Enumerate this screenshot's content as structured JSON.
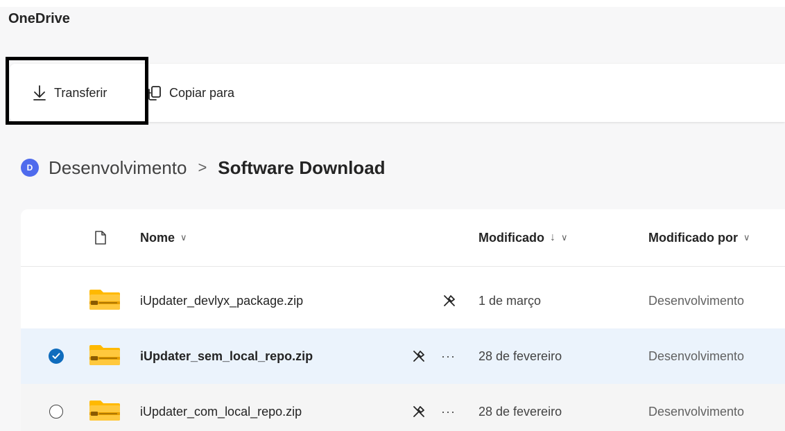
{
  "app": {
    "title": "OneDrive"
  },
  "toolbar": {
    "download_label": "Transferir",
    "copy_label": "Copiar para"
  },
  "breadcrumb": {
    "avatar_letter": "D",
    "parent": "Desenvolvimento",
    "separator": ">",
    "current": "Software Download"
  },
  "table": {
    "columns": {
      "name": "Nome",
      "modified": "Modificado",
      "modified_by": "Modificado por"
    },
    "sort_arrow": "↓",
    "chevron": "∨",
    "more_label": "···",
    "rows": [
      {
        "name": "iUpdater_devlyx_package.zip",
        "modified": "1 de março",
        "modified_by": "Desenvolvimento",
        "selected": false
      },
      {
        "name": "iUpdater_sem_local_repo.zip",
        "modified": "28 de fevereiro",
        "modified_by": "Desenvolvimento",
        "selected": true
      },
      {
        "name": "iUpdater_com_local_repo.zip",
        "modified": "28 de fevereiro",
        "modified_by": "Desenvolvimento",
        "selected": false
      }
    ]
  },
  "colors": {
    "accent": "#0f6cbd",
    "avatar": "#4f6bed",
    "folder_zip": "#ffb900",
    "selected_row": "#ebf3fc",
    "focus_outline": "#000000"
  },
  "icons": {
    "download": "arrow-down-icon",
    "copy": "copy-to-icon",
    "file_type": "document-icon",
    "zip": "zip-folder-icon",
    "share_off": "pin-off-icon",
    "more": "more-horizontal-icon",
    "checked": "checkmark-circle-icon",
    "unchecked": "circle-icon"
  }
}
